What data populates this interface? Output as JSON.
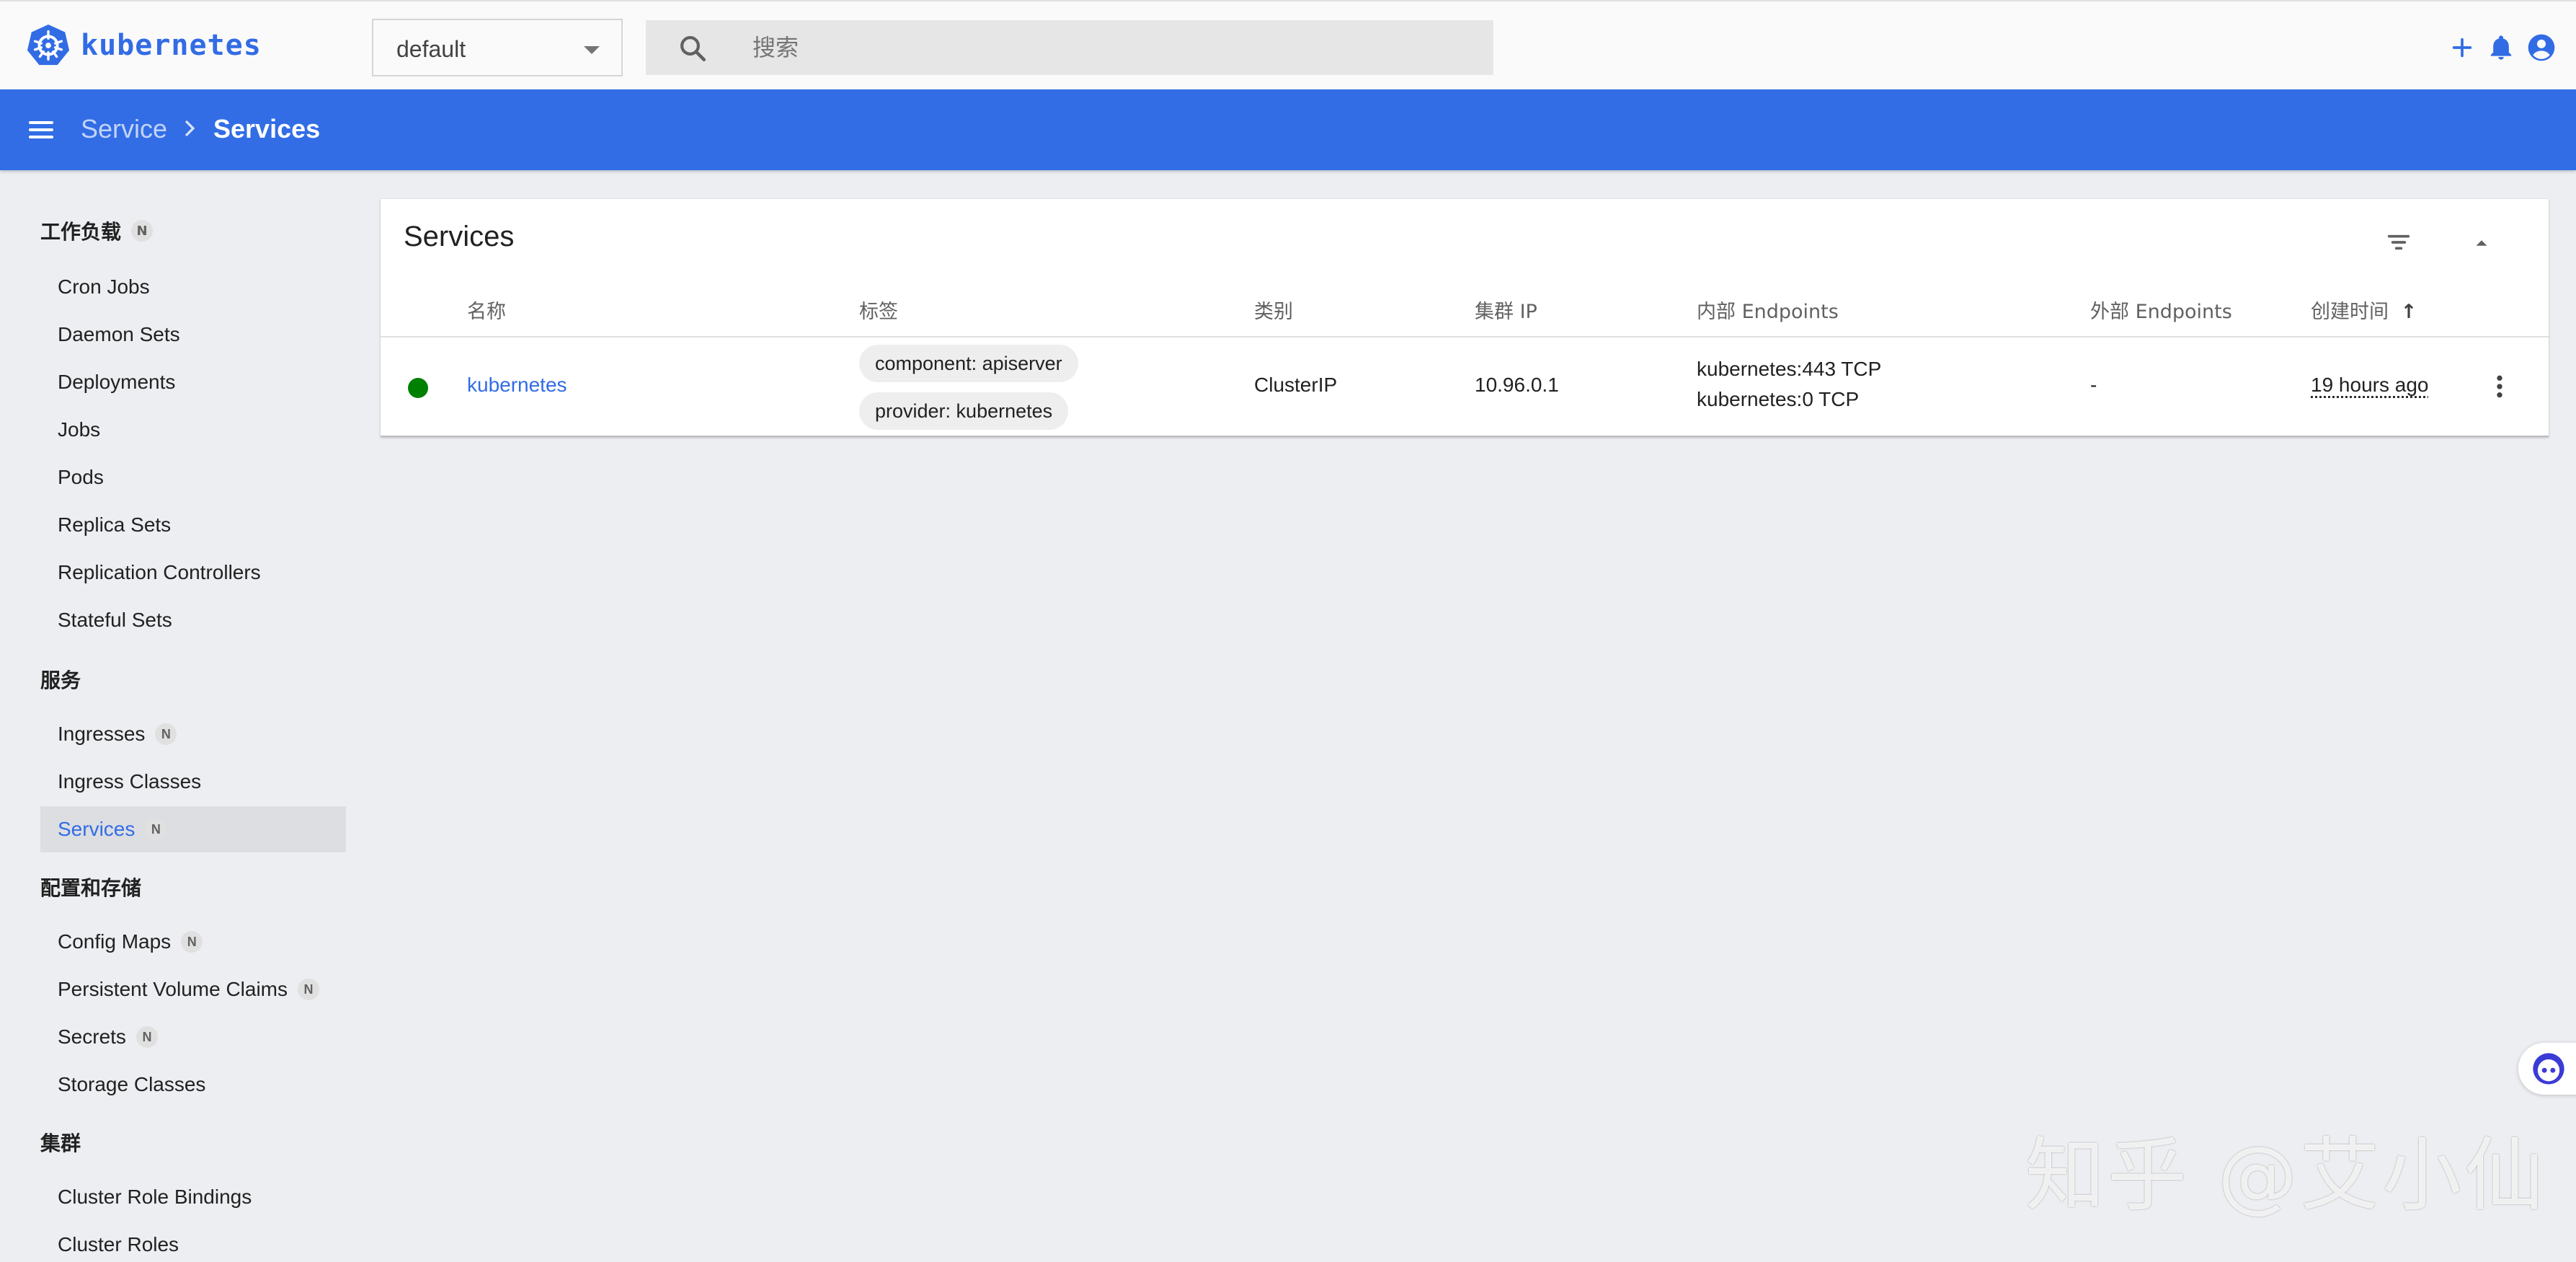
{
  "app": {
    "name": "kubernetes"
  },
  "header": {
    "namespace": "default",
    "search_placeholder": "搜索"
  },
  "breadcrumb": {
    "parent": "Service",
    "separator": "›",
    "current": "Services"
  },
  "sidebar": {
    "sections": [
      {
        "title": "工作负载",
        "badge": "N",
        "items": [
          {
            "label": "Cron Jobs"
          },
          {
            "label": "Daemon Sets"
          },
          {
            "label": "Deployments"
          },
          {
            "label": "Jobs"
          },
          {
            "label": "Pods"
          },
          {
            "label": "Replica Sets"
          },
          {
            "label": "Replication Controllers"
          },
          {
            "label": "Stateful Sets"
          }
        ]
      },
      {
        "title": "服务",
        "items": [
          {
            "label": "Ingresses",
            "badge": "N"
          },
          {
            "label": "Ingress Classes"
          },
          {
            "label": "Services",
            "badge": "N",
            "active": true
          }
        ]
      },
      {
        "title": "配置和存储",
        "items": [
          {
            "label": "Config Maps",
            "badge": "N"
          },
          {
            "label": "Persistent Volume Claims",
            "badge": "N"
          },
          {
            "label": "Secrets",
            "badge": "N"
          },
          {
            "label": "Storage Classes"
          }
        ]
      },
      {
        "title": "集群",
        "items": [
          {
            "label": "Cluster Role Bindings"
          },
          {
            "label": "Cluster Roles"
          }
        ]
      }
    ]
  },
  "card": {
    "title": "Services",
    "columns": [
      "名称",
      "标签",
      "类别",
      "集群 IP",
      "内部 Endpoints",
      "外部 Endpoints",
      "创建时间"
    ],
    "sort_indicator": "↑",
    "rows": [
      {
        "status_color": "#008000",
        "name": "kubernetes",
        "labels": [
          "component: apiserver",
          "provider: kubernetes"
        ],
        "type": "ClusterIP",
        "cluster_ip": "10.96.0.1",
        "internal_endpoints": [
          "kubernetes:443 TCP",
          "kubernetes:0 TCP"
        ],
        "external_endpoints": "-",
        "created": "19 hours ago"
      }
    ]
  },
  "watermark": "知乎 @艾小仙",
  "colors": {
    "primary": "#326ce5",
    "status_running": "#008000"
  }
}
